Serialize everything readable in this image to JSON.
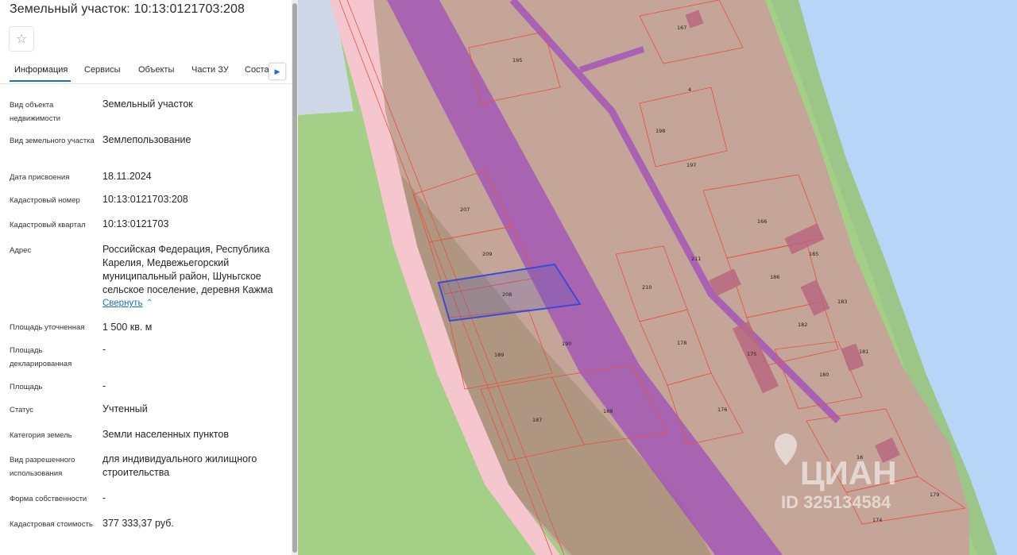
{
  "panel": {
    "title": "Земельный участок: 10:13:0121703:208",
    "favorite_icon": "star-icon",
    "tabs": [
      {
        "label": "Информация",
        "active": true
      },
      {
        "label": "Сервисы",
        "active": false
      },
      {
        "label": "Объекты",
        "active": false
      },
      {
        "label": "Части ЗУ",
        "active": false
      },
      {
        "label": "Соста",
        "active": false
      }
    ],
    "tabs_next_icon": "chevron-right-icon",
    "rows": {
      "object_type": {
        "label": "Вид объекта недвижимости",
        "value": "Земельный участок"
      },
      "land_type": {
        "label": "Вид земельного участка",
        "value": "Землепользование"
      },
      "assign_date": {
        "label": "Дата присвоения",
        "value": "18.11.2024"
      },
      "cadastral_number": {
        "label": "Кадастровый номер",
        "value": "10:13:0121703:208"
      },
      "cadastral_quarter": {
        "label": "Кадастровый квартал",
        "value": "10:13:0121703"
      },
      "address": {
        "label": "Адрес",
        "value": "Российская Федерация, Республика Карелия, Медвежьегорский муниципальный район, Шуньгское сельское поселение, деревня Кажма"
      },
      "area_specified": {
        "label": "Площадь уточненная",
        "value": "1 500 кв. м"
      },
      "area_declared": {
        "label": "Площадь декларированная",
        "value": "-"
      },
      "area": {
        "label": "Площадь",
        "value": "-"
      },
      "status": {
        "label": "Статус",
        "value": "Учтенный"
      },
      "land_category": {
        "label": "Категория земель",
        "value": "Земли населенных пунктов"
      },
      "permitted_use": {
        "label": "Вид разрешенного использования",
        "value": "для индивидуального жилищного строительства"
      },
      "ownership_form": {
        "label": "Форма собственности",
        "value": "-"
      },
      "cadastral_value": {
        "label": "Кадастровая стоимость",
        "value": "377 333,37 руб."
      }
    },
    "collapse_link": "Свернуть",
    "collapse_icon": "chevron-up-icon"
  },
  "map": {
    "colors": {
      "water": "#b7d6f7",
      "grass": "#a3cf86",
      "parcel_fill": "#c7a29a",
      "parcel_border": "#e8523d",
      "road": "#f6c6cf",
      "power_line": "#a455b7",
      "selected_outline": "#3a4bd8"
    },
    "parcel_labels": [
      "167",
      "195",
      "4",
      "198",
      "197",
      "166",
      "207",
      "209",
      "211",
      "185",
      "186",
      "210",
      "183",
      "208",
      "182",
      "190",
      "178",
      "175",
      "181",
      "189",
      "180",
      "176",
      "187",
      "188",
      "16",
      "179",
      "174"
    ],
    "watermark": {
      "brand": "ЦИАН",
      "id_text": "ID 325134584",
      "icon": "location-pin-icon"
    }
  }
}
